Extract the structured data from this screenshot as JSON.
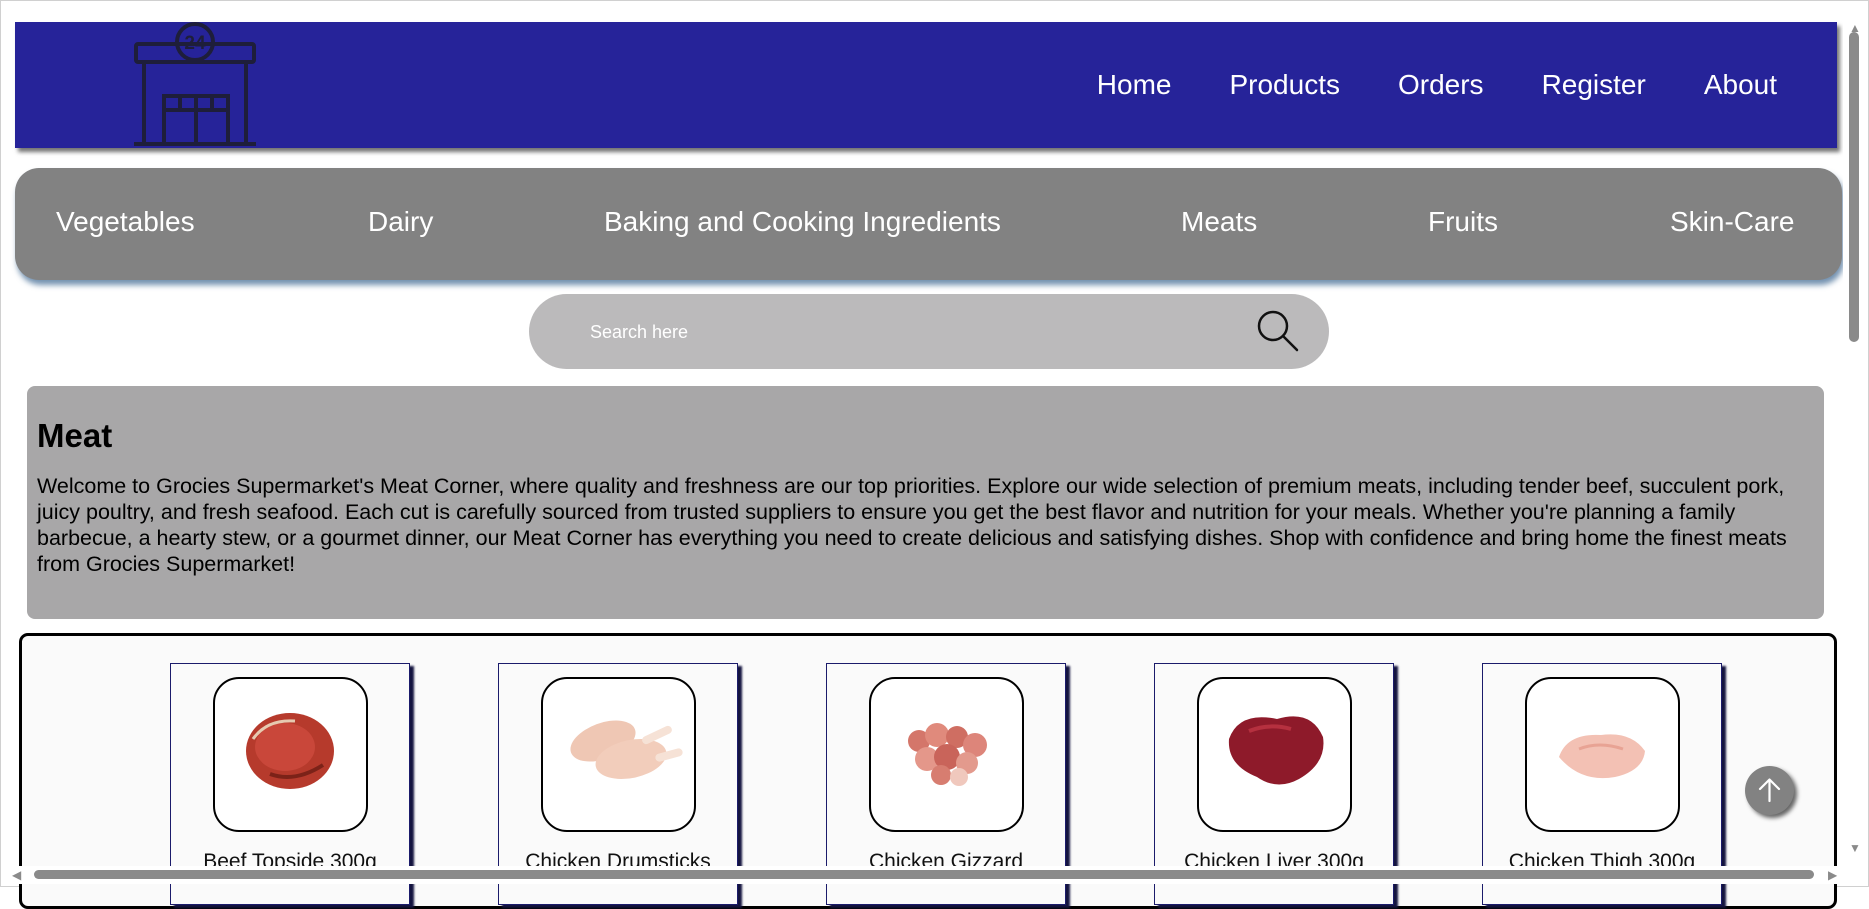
{
  "header": {
    "logo_icon": "store-24h-icon",
    "logo_badge": "24",
    "nav": [
      {
        "label": "Home"
      },
      {
        "label": "Products"
      },
      {
        "label": "Orders"
      },
      {
        "label": "Register"
      },
      {
        "label": "About"
      }
    ]
  },
  "categories": [
    {
      "label": "Vegetables"
    },
    {
      "label": "Dairy"
    },
    {
      "label": "Baking and Cooking Ingredients"
    },
    {
      "label": "Meats"
    },
    {
      "label": "Fruits"
    },
    {
      "label": "Skin-Care"
    }
  ],
  "search": {
    "placeholder": "Search here",
    "icon": "search-icon"
  },
  "intro": {
    "title": "Meat",
    "text": "Welcome to Grocies Supermarket's Meat Corner, where quality and freshness are our top priorities. Explore our wide selection of premium meats, including tender beef, succulent pork, juicy poultry, and fresh seafood. Each cut is carefully sourced from trusted suppliers to ensure you get the best flavor and nutrition for your meals. Whether you're planning a family barbecue, a hearty stew, or a gourmet dinner, our Meat Corner has everything you need to create delicious and satisfying dishes. Shop with confidence and bring home the finest meats from Grocies Supermarket!"
  },
  "products": [
    {
      "name": "Beef Topside 300g",
      "image": "beef-topside-image"
    },
    {
      "name": "Chicken Drumsticks",
      "image": "chicken-drumsticks-image"
    },
    {
      "name": "Chicken Gizzard",
      "image": "chicken-gizzard-image"
    },
    {
      "name": "Chicken Liver 300g",
      "image": "chicken-liver-image"
    },
    {
      "name": "Chicken Thigh 300g",
      "image": "chicken-thigh-image"
    }
  ],
  "back_to_top": {
    "icon": "arrow-up-icon"
  },
  "colors": {
    "header_bg": "#262399",
    "category_bg": "#828282",
    "search_bg": "#bbbabb",
    "intro_bg": "#a8a7a8"
  }
}
